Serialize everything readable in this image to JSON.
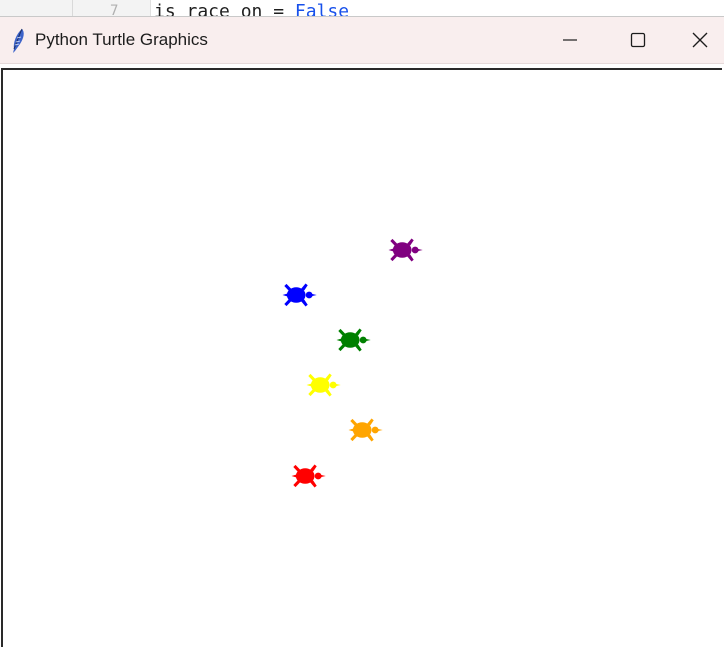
{
  "editor": {
    "line_number": "7",
    "code_prefix": "is_race_on = ",
    "code_keyword": "False"
  },
  "window": {
    "title": "Python Turtle Graphics",
    "icon": "feather-icon",
    "controls": {
      "minimize": "minimize-icon",
      "maximize": "maximize-icon",
      "close": "close-icon"
    }
  },
  "turtles": [
    {
      "color": "#800080",
      "name": "purple"
    },
    {
      "color": "#0000ff",
      "name": "blue"
    },
    {
      "color": "#008000",
      "name": "green"
    },
    {
      "color": "#ffff00",
      "name": "yellow"
    },
    {
      "color": "#ffa500",
      "name": "orange"
    },
    {
      "color": "#ff0000",
      "name": "red"
    }
  ]
}
